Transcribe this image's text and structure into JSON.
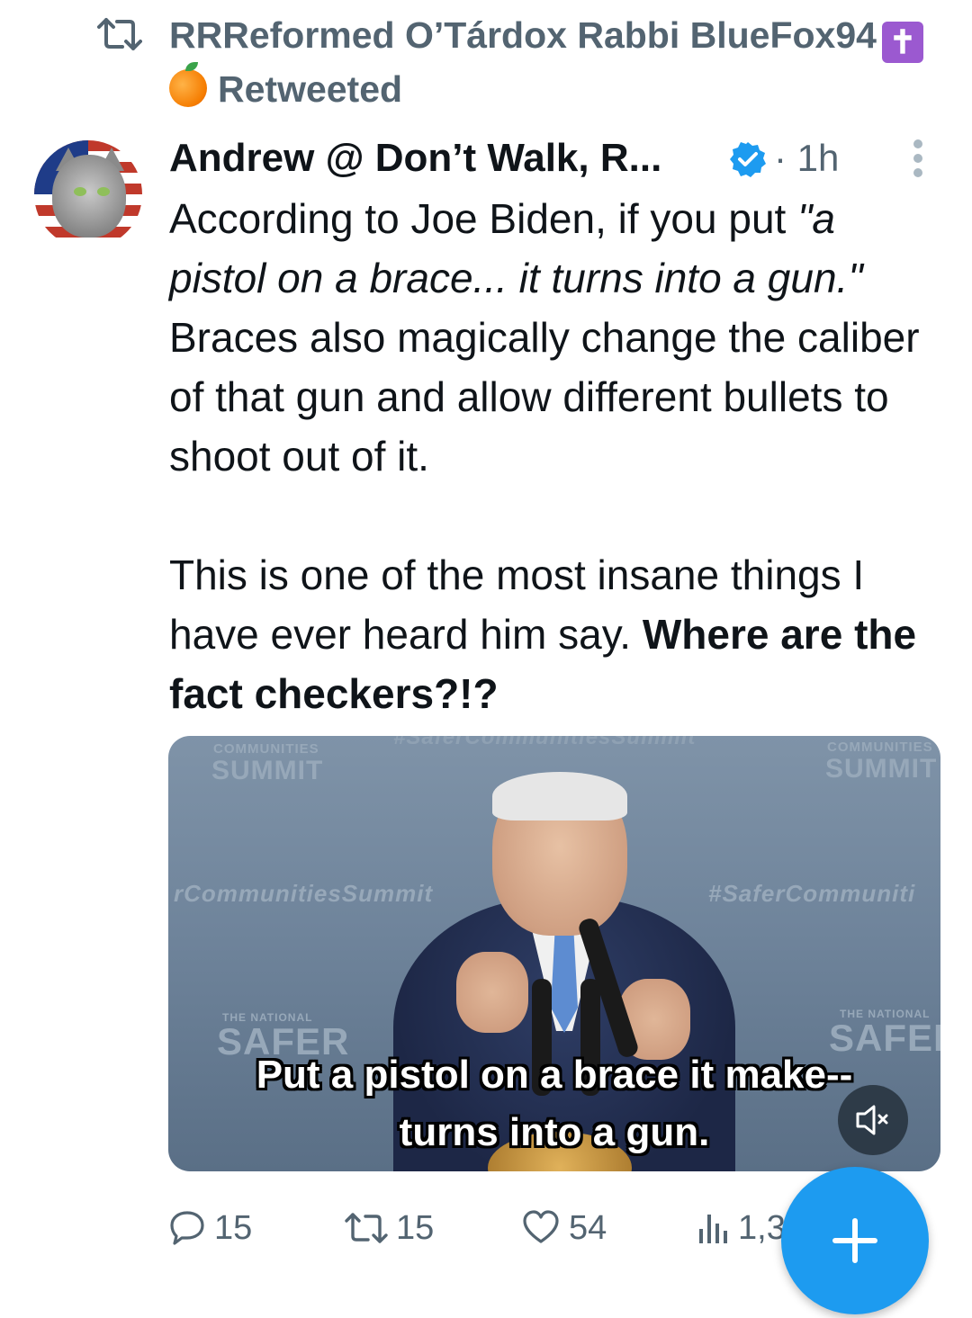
{
  "retweet_banner": {
    "line1": "RRReformed O’Tárdox Rabbi BlueFox94",
    "line2": "Retweeted",
    "emoji_cross": "✝",
    "emoji_orange": "orange-emoji"
  },
  "author": {
    "display_name": "Andrew @ Don’t Walk, R...",
    "verified": true,
    "time": "· 1h",
    "avatar": "cat-on-american-flag-avatar"
  },
  "tweet": {
    "p1_normal": "According to Joe Biden, if you put ",
    "p1_italic": "\"a pistol on a brace... it turns into a gun.\"",
    "p1_rest": "\nBraces also magically change the caliber of that gun and allow different bullets to shoot out of it.\n\nThis is one of the most insane things I have ever heard him say. ",
    "p2_bold": "Where are the fact checkers?!?"
  },
  "media": {
    "banner_top_left_small": "COMMUNITIES",
    "banner_top_left": "SUMMIT",
    "banner_top_center": "#SaferCommunitiesSummit",
    "banner_top_right_small": "COMMUNITIES",
    "banner_top_right": "SUMMIT",
    "banner_mid_left": "rCommunitiesSummit",
    "banner_mid_right": "#SaferCommuniti",
    "banner_bottom_left_small": "THE NATIONAL",
    "banner_bottom_left": "SAFER",
    "banner_bottom_right_small": "THE NATIONAL",
    "banner_bottom_right": "SAFER",
    "caption_line1": "Put a pistol on a brace it make--",
    "caption_line2": "turns into a gun.",
    "mute_icon": "speaker-muted-icon"
  },
  "actions": {
    "replies": "15",
    "retweets": "15",
    "likes": "54",
    "views": "1,3"
  },
  "colors": {
    "accent": "#1d9bf0",
    "secondary_text": "#536471",
    "primary_text": "#0f1419"
  }
}
